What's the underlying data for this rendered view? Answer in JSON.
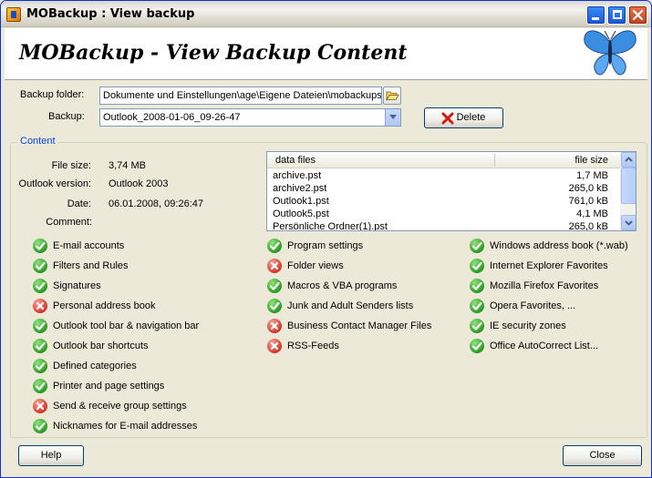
{
  "window": {
    "title": "MOBackup : View backup"
  },
  "header": {
    "title": "MOBackup - View Backup Content"
  },
  "form": {
    "backup_folder_label": "Backup folder:",
    "backup_folder_value": "Dokumente und Einstellungen\\age\\Eigene Dateien\\mobackups\\",
    "backup_label": "Backup:",
    "backup_value": "Outlook_2008-01-06_09-26-47",
    "delete_label": "Delete"
  },
  "content": {
    "group_title": "Content",
    "file_size_label": "File size:",
    "file_size_value": "3,74 MB",
    "outlook_version_label": "Outlook version:",
    "outlook_version_value": "Outlook 2003",
    "date_label": "Date:",
    "date_value": "06.01.2008, 09:26:47",
    "comment_label": "Comment:"
  },
  "files": {
    "columns": [
      "data files",
      "file size"
    ],
    "rows": [
      {
        "name": "archive.pst",
        "size": "1,7 MB"
      },
      {
        "name": "archive2.pst",
        "size": "265,0 kB"
      },
      {
        "name": "Outlook1.pst",
        "size": "761,0 kB"
      },
      {
        "name": "Outlook5.pst",
        "size": "4,1 MB"
      },
      {
        "name": "Persönliche Ordner(1).pst",
        "size": "265,0 kB"
      }
    ]
  },
  "options": {
    "col1": [
      {
        "label": "E-mail accounts",
        "status": "ok"
      },
      {
        "label": "Filters and Rules",
        "status": "ok"
      },
      {
        "label": "Signatures",
        "status": "ok"
      },
      {
        "label": "Personal address book",
        "status": "no"
      },
      {
        "label": "Outlook tool bar & navigation bar",
        "status": "ok"
      },
      {
        "label": "Outlook bar shortcuts",
        "status": "ok"
      },
      {
        "label": "Defined categories",
        "status": "ok"
      },
      {
        "label": "Printer and page settings",
        "status": "ok"
      },
      {
        "label": "Send & receive group settings",
        "status": "no"
      },
      {
        "label": "Nicknames for E-mail addresses",
        "status": "ok"
      }
    ],
    "col2": [
      {
        "label": "Program settings",
        "status": "ok"
      },
      {
        "label": "Folder views",
        "status": "no"
      },
      {
        "label": "Macros & VBA programs",
        "status": "ok"
      },
      {
        "label": "Junk and Adult Senders lists",
        "status": "ok"
      },
      {
        "label": "Business Contact Manager Files",
        "status": "no"
      },
      {
        "label": "RSS-Feeds",
        "status": "no"
      }
    ],
    "col3": [
      {
        "label": "Windows address book (*.wab)",
        "status": "ok"
      },
      {
        "label": "Internet Explorer Favorites",
        "status": "ok"
      },
      {
        "label": "Mozilla Firefox Favorites",
        "status": "ok"
      },
      {
        "label": "Opera Favorites, ...",
        "status": "ok"
      },
      {
        "label": "IE security zones",
        "status": "ok"
      },
      {
        "label": "Office AutoCorrect List...",
        "status": "ok"
      }
    ]
  },
  "footer": {
    "help_label": "Help",
    "close_label": "Close"
  },
  "colors": {
    "ok": "#2c9a23",
    "no": "#d5372a",
    "group_title": "#0046d5"
  }
}
